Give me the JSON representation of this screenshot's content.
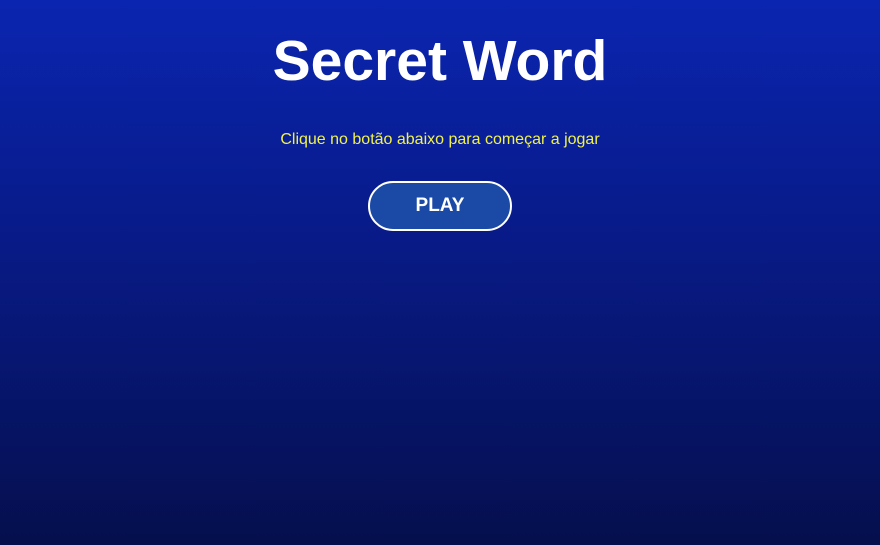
{
  "game": {
    "title": "Secret Word",
    "instructions": "Clique no botão abaixo para começar a jogar",
    "play_label": "PLAY"
  },
  "colors": {
    "background_top": "#0a25b0",
    "background_bottom": "#050f4d",
    "title": "#ffffff",
    "instructions": "#f2f24a",
    "button_fill": "#1b4aa6",
    "button_border": "#ffffff"
  }
}
